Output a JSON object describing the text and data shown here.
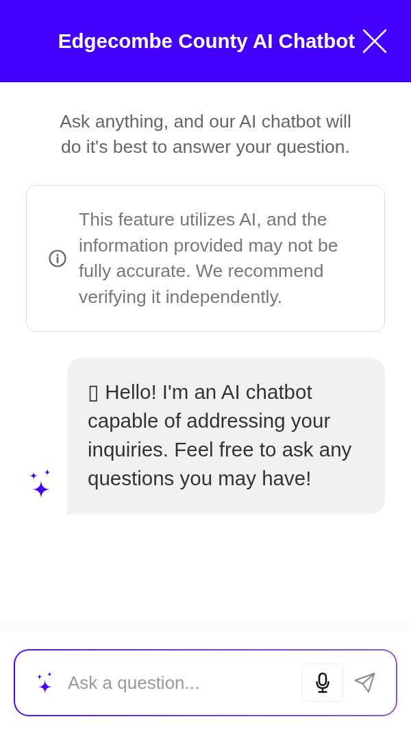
{
  "header": {
    "title": "Edgecombe County AI Chatbot"
  },
  "intro": "Ask anything, and our AI chatbot will do it's best to answer your question.",
  "notice": {
    "text": "This feature utilizes AI, and the information provided may not be fully accurate. We recommend verifying it independently."
  },
  "messages": [
    {
      "kind": "bot",
      "text": "▯ Hello! I'm an AI chatbot capable of addressing your inquiries. Feel free to ask any questions you may have!"
    }
  ],
  "composer": {
    "placeholder": "Ask a question..."
  }
}
